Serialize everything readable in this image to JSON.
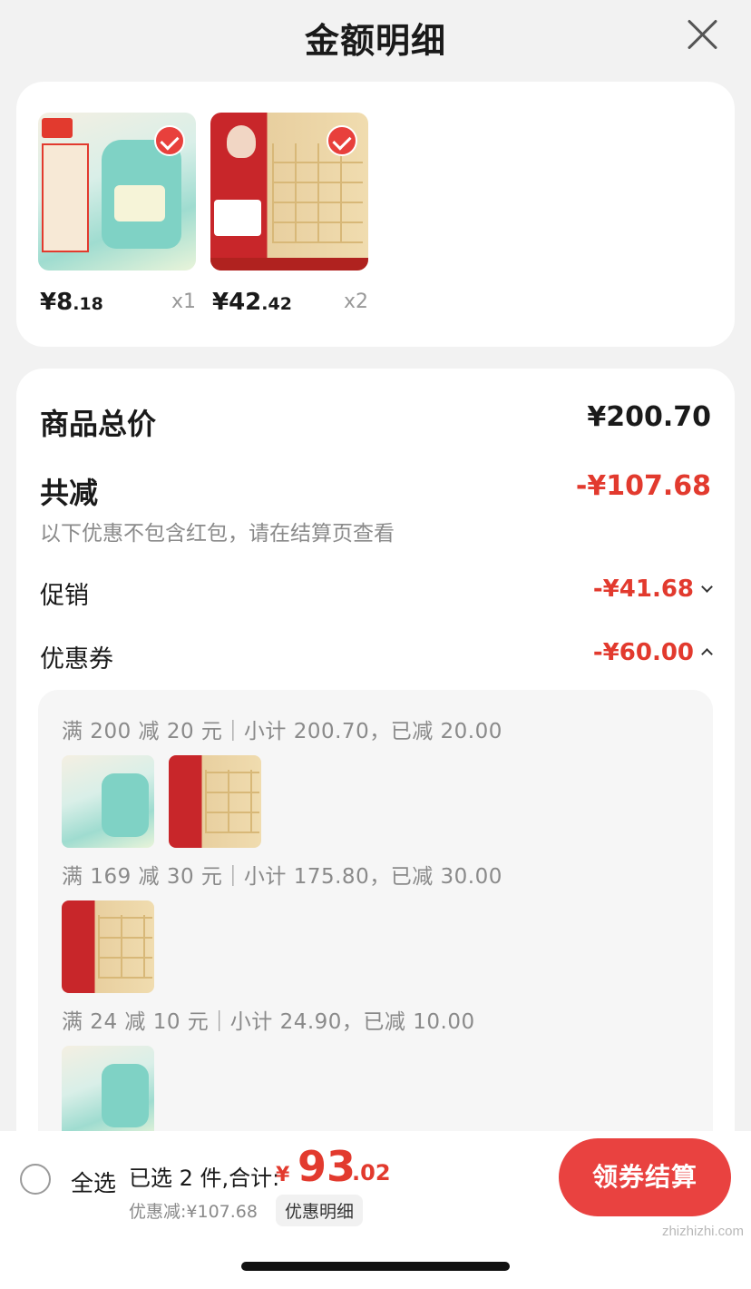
{
  "header": {
    "title": "金额明细",
    "close_icon": "close-icon"
  },
  "products": [
    {
      "name": "laundry-detergent",
      "price_int": "¥8",
      "price_dec": ".18",
      "qty": "x1",
      "checked": true
    },
    {
      "name": "paper-tissue",
      "price_int": "¥42",
      "price_dec": ".42",
      "qty": "x2",
      "checked": true
    }
  ],
  "summary": {
    "total_label": "商品总价",
    "total_value": "¥200.70",
    "reduce_label": "共减",
    "reduce_value": "-¥107.68",
    "reduce_note": "以下优惠不包含红包，请在结算页查看",
    "promo_label": "促销",
    "promo_value": "-¥41.68",
    "coupon_label": "优惠券",
    "coupon_value": "-¥60.00"
  },
  "coupon_groups": [
    {
      "text": "满 200 减 20 元｜小计 200.70，已减 20.00",
      "items": [
        "laundry-detergent",
        "paper-tissue"
      ]
    },
    {
      "text": "满 169 减 30 元｜小计 175.80，已减 30.00",
      "items": [
        "paper-tissue"
      ]
    },
    {
      "text": "满 24 减 10 元｜小计 24.90，已减 10.00",
      "items": [
        "laundry-detergent"
      ]
    }
  ],
  "bottom_bar": {
    "select_all": "全选",
    "selected_text": "已选 2 件,合计:",
    "currency": "¥",
    "total_int": "93",
    "total_dec": ".02",
    "discount_text": "优惠减:¥107.68",
    "detail_button": "优惠明细",
    "checkout_button": "领券结算"
  },
  "watermark": "zhizhizhi.com",
  "colors": {
    "accent_red": "#e23a2e",
    "checkout_red": "#e94240"
  }
}
